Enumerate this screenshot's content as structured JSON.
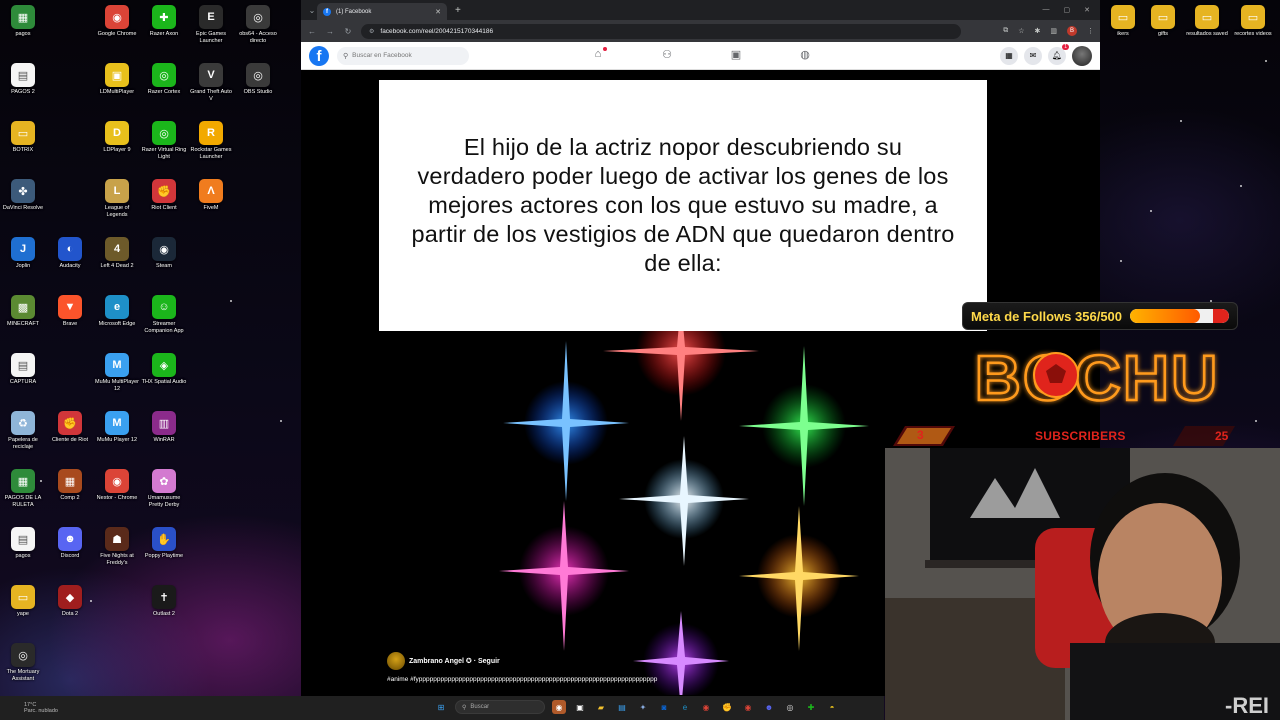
{
  "desktop_icons": [
    {
      "label": "pagos",
      "color": "#2e8b3a",
      "glyph": "▦"
    },
    {
      "label": "Google Chrome",
      "color": "#db4437",
      "glyph": "◉"
    },
    {
      "label": "Razer Axon",
      "color": "#1bb61b",
      "glyph": "✚"
    },
    {
      "label": "Epic Games Launcher",
      "color": "#2a2a2a",
      "glyph": "E"
    },
    {
      "label": "obs64 - Acceso directo",
      "color": "#3a3a3a",
      "glyph": "◎"
    },
    {
      "label": "PAGOS 2",
      "color": "#f5f5f5",
      "glyph": "▤"
    },
    {
      "label": "LDMultiPlayer",
      "color": "#e8c01c",
      "glyph": "▣"
    },
    {
      "label": "Razer Cortex",
      "color": "#1bb61b",
      "glyph": "◎"
    },
    {
      "label": "Grand Theft Auto V",
      "color": "#3a3a3a",
      "glyph": "V"
    },
    {
      "label": "OBS Studio",
      "color": "#3a3a3a",
      "glyph": "◎"
    },
    {
      "label": "BOTRIX",
      "color": "#e6b422",
      "glyph": "▭"
    },
    {
      "label": "LDPlayer 9",
      "color": "#e8c01c",
      "glyph": "D"
    },
    {
      "label": "Razer Virtual Ring Light",
      "color": "#1bb61b",
      "glyph": "◎"
    },
    {
      "label": "Rockstar Games Launcher",
      "color": "#f2a900",
      "glyph": "R"
    },
    {
      "label": "DaVinci Resolve",
      "color": "#3c5a7a",
      "glyph": "✤"
    },
    {
      "label": "League of Legends",
      "color": "#c8a24a",
      "glyph": "L"
    },
    {
      "label": "Riot Client",
      "color": "#d1363a",
      "glyph": "✊"
    },
    {
      "label": "FiveM",
      "color": "#f07c1e",
      "glyph": "Λ"
    },
    {
      "label": "Joplin",
      "color": "#1f6fd1",
      "glyph": "J"
    },
    {
      "label": "Audacity",
      "color": "#2255cc",
      "glyph": "◐"
    },
    {
      "label": "Left 4 Dead 2",
      "color": "#6d5a2a",
      "glyph": "4"
    },
    {
      "label": "Steam",
      "color": "#1b2838",
      "glyph": "◉"
    },
    {
      "label": "MINECRAFT",
      "color": "#5b8a32",
      "glyph": "▩"
    },
    {
      "label": "Brave",
      "color": "#fb542b",
      "glyph": "▼"
    },
    {
      "label": "Microsoft Edge",
      "color": "#1e90c8",
      "glyph": "e"
    },
    {
      "label": "Streamer Companion App",
      "color": "#1bb61b",
      "glyph": "☺"
    },
    {
      "label": "CAPTURA",
      "color": "#f5f5f5",
      "glyph": "▤"
    },
    {
      "label": "MuMu MultiPlayer 12",
      "color": "#3aa0f0",
      "glyph": "M"
    },
    {
      "label": "THX Spatial Audio",
      "color": "#1bb61b",
      "glyph": "◈"
    },
    {
      "label": "Papelera de reciclaje",
      "color": "#8fb5d8",
      "glyph": "♻"
    },
    {
      "label": "Cliente de Riot",
      "color": "#d1363a",
      "glyph": "✊"
    },
    {
      "label": "MuMu Player 12",
      "color": "#3aa0f0",
      "glyph": "M"
    },
    {
      "label": "WinRAR",
      "color": "#8b2b8b",
      "glyph": "▥"
    },
    {
      "label": "PAGOS DE LA RULETA",
      "color": "#2e8b3a",
      "glyph": "▦"
    },
    {
      "label": "Comp 2",
      "color": "#a84a1e",
      "glyph": "▦"
    },
    {
      "label": "Nestor - Chrome",
      "color": "#db4437",
      "glyph": "◉"
    },
    {
      "label": "Umamusume Pretty Derby",
      "color": "#d37ad0",
      "glyph": "✿"
    },
    {
      "label": "pagos",
      "color": "#f5f5f5",
      "glyph": "▤"
    },
    {
      "label": "Discord",
      "color": "#5865f2",
      "glyph": "☻"
    },
    {
      "label": "Five Nights at Freddy's",
      "color": "#5a2a1a",
      "glyph": "☗"
    },
    {
      "label": "Poppy Playtime",
      "color": "#2a50c8",
      "glyph": "✋"
    },
    {
      "label": "yape",
      "color": "#e6b422",
      "glyph": "▭"
    },
    {
      "label": "Dota 2",
      "color": "#a01e1e",
      "glyph": "◆"
    },
    {
      "label": "Outlast 2",
      "color": "#1a1a1a",
      "glyph": "✝"
    },
    {
      "label": "The Mortuary Assistant",
      "color": "#2a2a2a",
      "glyph": "◎"
    }
  ],
  "right_desktop_icons": [
    {
      "label": "ikers"
    },
    {
      "label": "gifts"
    },
    {
      "label": "resultados saved"
    },
    {
      "label": "recortes videos"
    }
  ],
  "browser": {
    "tab_title": "(1) Facebook",
    "url": "facebook.com/reel/2004215170344186",
    "colors": {
      "fb_blue": "#1877f2",
      "chrome_dark": "#35363a"
    }
  },
  "facebook": {
    "search_placeholder": "Buscar en Facebook",
    "notification_count": "1",
    "reel": {
      "caption": "El hijo de la actriz nopor descubriendo su verdadero poder luego de activar los genes de los mejores actores con los que estuvo su madre, a partir de los vestigios de ADN que quedaron dentro de ella:",
      "author": "Zambrano Angel ✪ · Seguir",
      "hashtags": "#anime #fypppppppppppppppppppppppppppppppppppppppppppppppppppppppppppppppppp"
    }
  },
  "taskbar": {
    "weather_temp": "17°C",
    "weather_desc": "Parc. nublado",
    "search_placeholder": "Buscar"
  },
  "overlay": {
    "follows_text": "Meta de Follows 356/500",
    "follows_current": 356,
    "follows_goal": 500,
    "logo_text": "BOCHU",
    "subs_label": "SUBSCRIBERS",
    "subs_left": "3",
    "subs_right": "25",
    "shirt_text": "-REI"
  }
}
